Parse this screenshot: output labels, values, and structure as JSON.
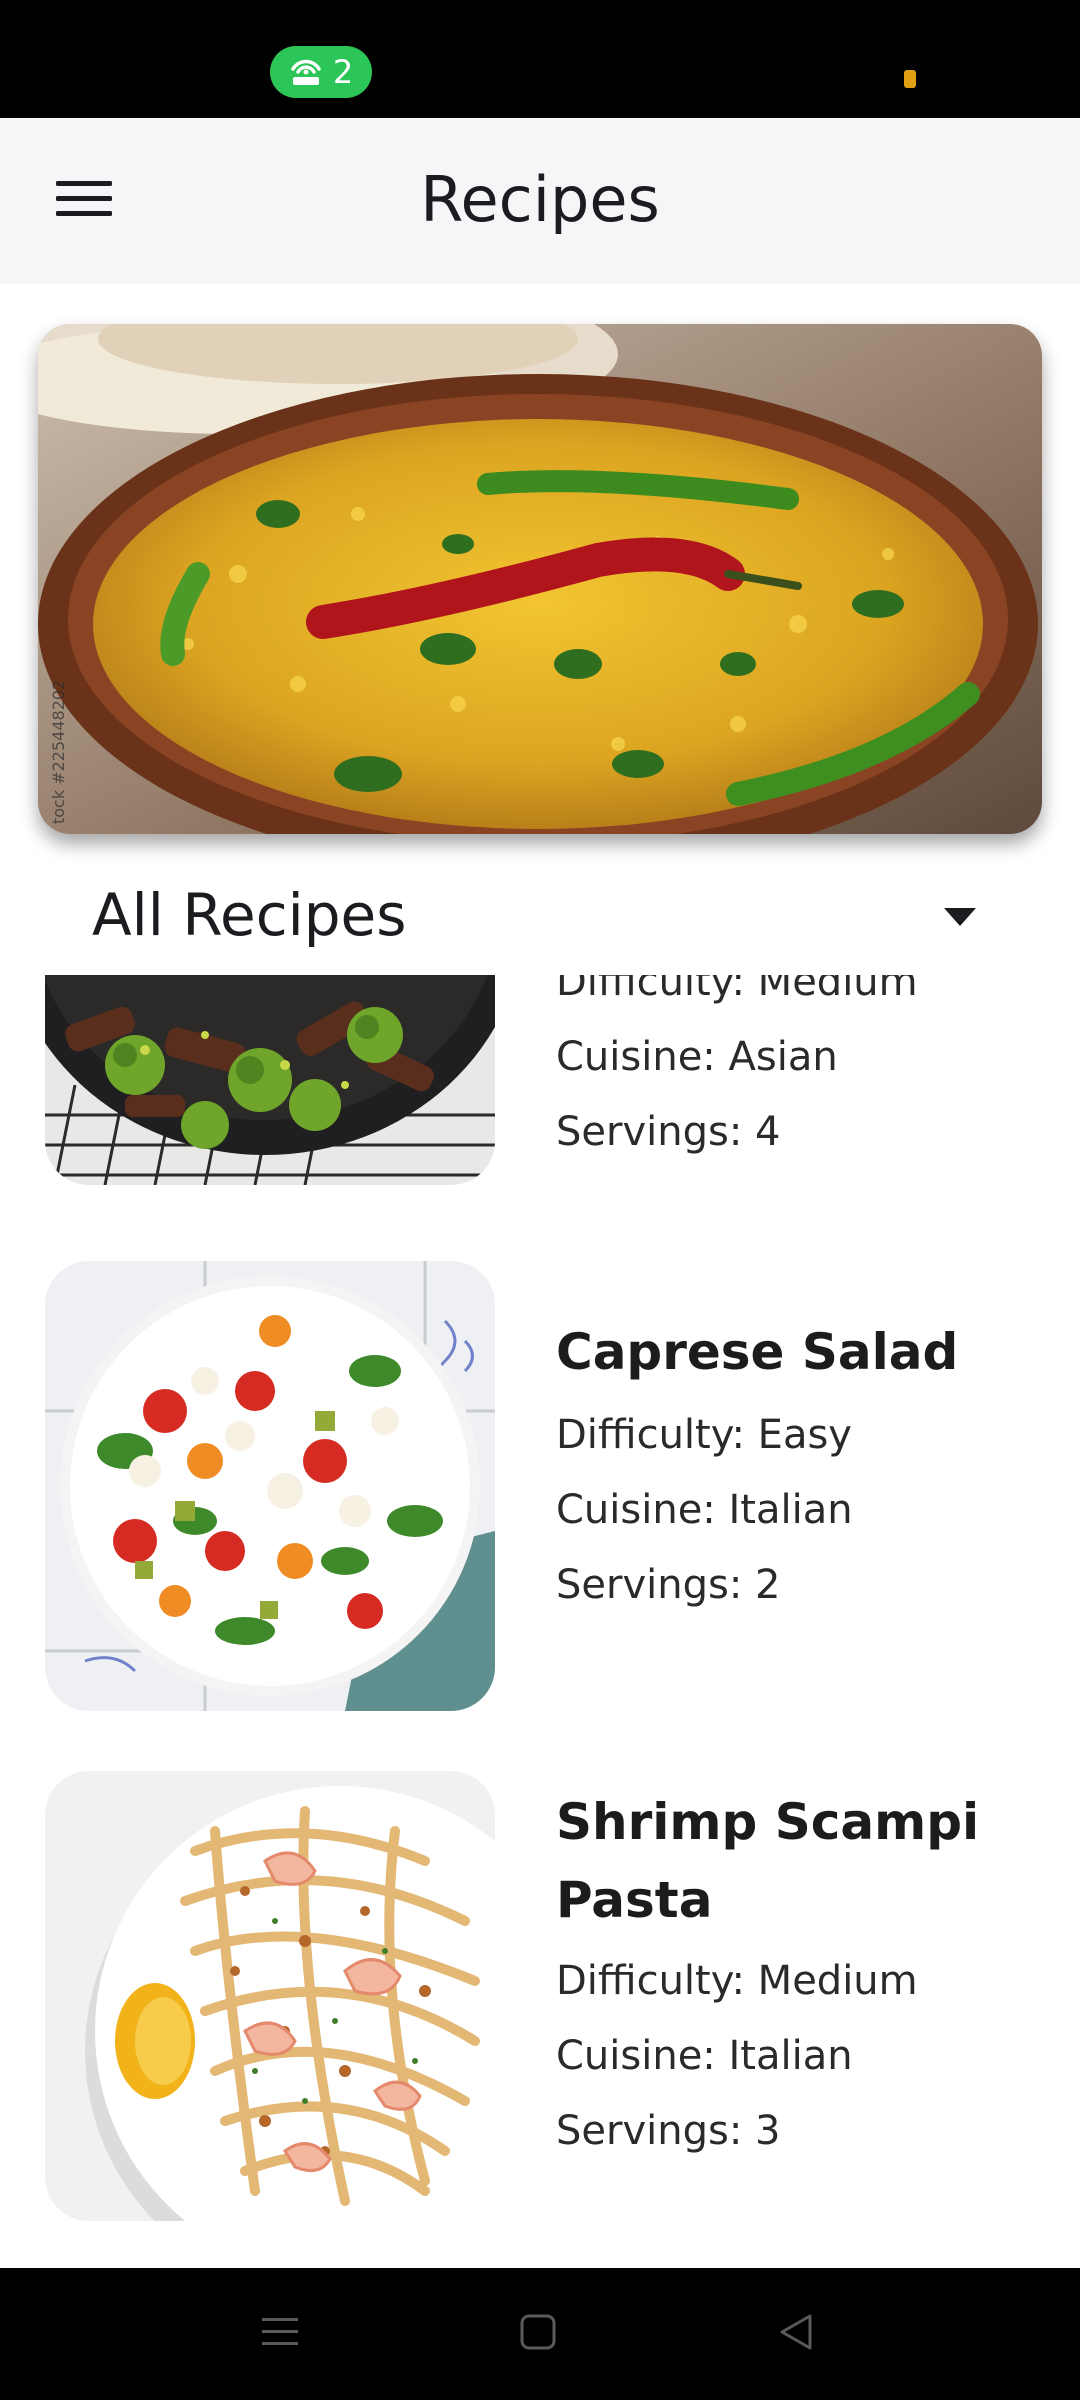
{
  "status_bar": {
    "hotspot_count": "2",
    "icons": [
      "hotspot-icon",
      "battery-icon"
    ],
    "colors": {
      "pill": "#2bc657",
      "background": "#000000"
    }
  },
  "app_bar": {
    "title": "Recipes",
    "menu_icon": "hamburger-menu-icon"
  },
  "hero": {
    "image": "dal-tadka-bowl-photo",
    "watermark": "tock #225448202"
  },
  "filter": {
    "selected": "All Recipes",
    "icon": "dropdown-caret-icon"
  },
  "recipes": [
    {
      "name": "",
      "difficulty": "Difficulty: Medium",
      "cuisine": "Cuisine: Asian",
      "servings": "Servings: 4",
      "image": "beef-broccoli-skillet-photo"
    },
    {
      "name": "Caprese Salad",
      "difficulty": "Difficulty: Easy",
      "cuisine": "Cuisine: Italian",
      "servings": "Servings: 2",
      "image": "caprese-salad-plate-photo"
    },
    {
      "name": "Shrimp Scampi Pasta",
      "difficulty": "Difficulty: Medium",
      "cuisine": "Cuisine: Italian",
      "servings": "Servings: 3",
      "image": "shrimp-scampi-pasta-photo"
    }
  ],
  "nav_bar": {
    "buttons": [
      "recents-icon",
      "home-icon",
      "back-icon"
    ]
  }
}
